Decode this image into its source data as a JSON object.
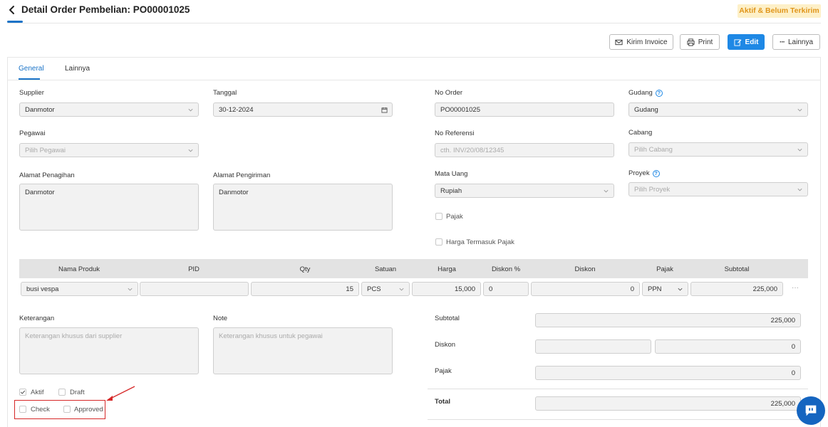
{
  "header": {
    "title": "Detail Order Pembelian: PO00001025",
    "status": "Aktif & Belum Terkirim"
  },
  "toolbar": {
    "kirim_invoice": "Kirim Invoice",
    "print": "Print",
    "edit": "Edit",
    "lainnya": "Lainnya"
  },
  "tabs": [
    "General",
    "Lainnya"
  ],
  "form": {
    "supplier_label": "Supplier",
    "supplier_value": "Danmotor",
    "tanggal_label": "Tanggal",
    "tanggal_value": "30-12-2024",
    "no_order_label": "No Order",
    "no_order_value": "PO00001025",
    "gudang_label": "Gudang",
    "gudang_value": "Gudang",
    "pegawai_label": "Pegawai",
    "pegawai_placeholder": "Pilih Pegawai",
    "no_referensi_label": "No Referensi",
    "no_referensi_placeholder": "cth. INV/20/08/12345",
    "cabang_label": "Cabang",
    "cabang_placeholder": "Pilih Cabang",
    "alamat_penagihan_label": "Alamat Penagihan",
    "alamat_penagihan_value": "Danmotor",
    "alamat_pengiriman_label": "Alamat Pengiriman",
    "alamat_pengiriman_value": "Danmotor",
    "mata_uang_label": "Mata Uang",
    "mata_uang_value": "Rupiah",
    "proyek_label": "Proyek",
    "proyek_placeholder": "Pilih Proyek",
    "pajak_checkbox": "Pajak",
    "harga_termasuk_pajak": "Harga Termasuk Pajak"
  },
  "table": {
    "headers": [
      "Nama Produk",
      "PID",
      "Qty",
      "Satuan",
      "Harga",
      "Diskon %",
      "Diskon",
      "Pajak",
      "Subtotal"
    ],
    "row": {
      "nama_produk": "busi vespa",
      "pid": "",
      "qty": "15",
      "satuan": "PCS",
      "harga": "15,000",
      "diskon_persen": "0",
      "diskon": "0",
      "pajak": "PPN",
      "subtotal": "225,000",
      "more": "···"
    }
  },
  "notes": {
    "keterangan_label": "Keterangan",
    "keterangan_placeholder": "Keterangan khusus dari supplier",
    "note_label": "Note",
    "note_placeholder": "Keterangan khusus untuk pegawai"
  },
  "flags": {
    "aktif": "Aktif",
    "draft": "Draft",
    "check": "Check",
    "approved": "Approved"
  },
  "summary": {
    "subtotal_label": "Subtotal",
    "subtotal_value": "225,000",
    "diskon_label": "Diskon",
    "diskon_value": "0",
    "pajak_label": "Pajak",
    "pajak_value": "0",
    "total_label": "Total",
    "total_value": "225,000"
  },
  "colors": {
    "primary": "#1e88e5",
    "status_bg": "#fdf0c8",
    "status_text": "#e0951a",
    "annotation_red": "#d62828"
  }
}
